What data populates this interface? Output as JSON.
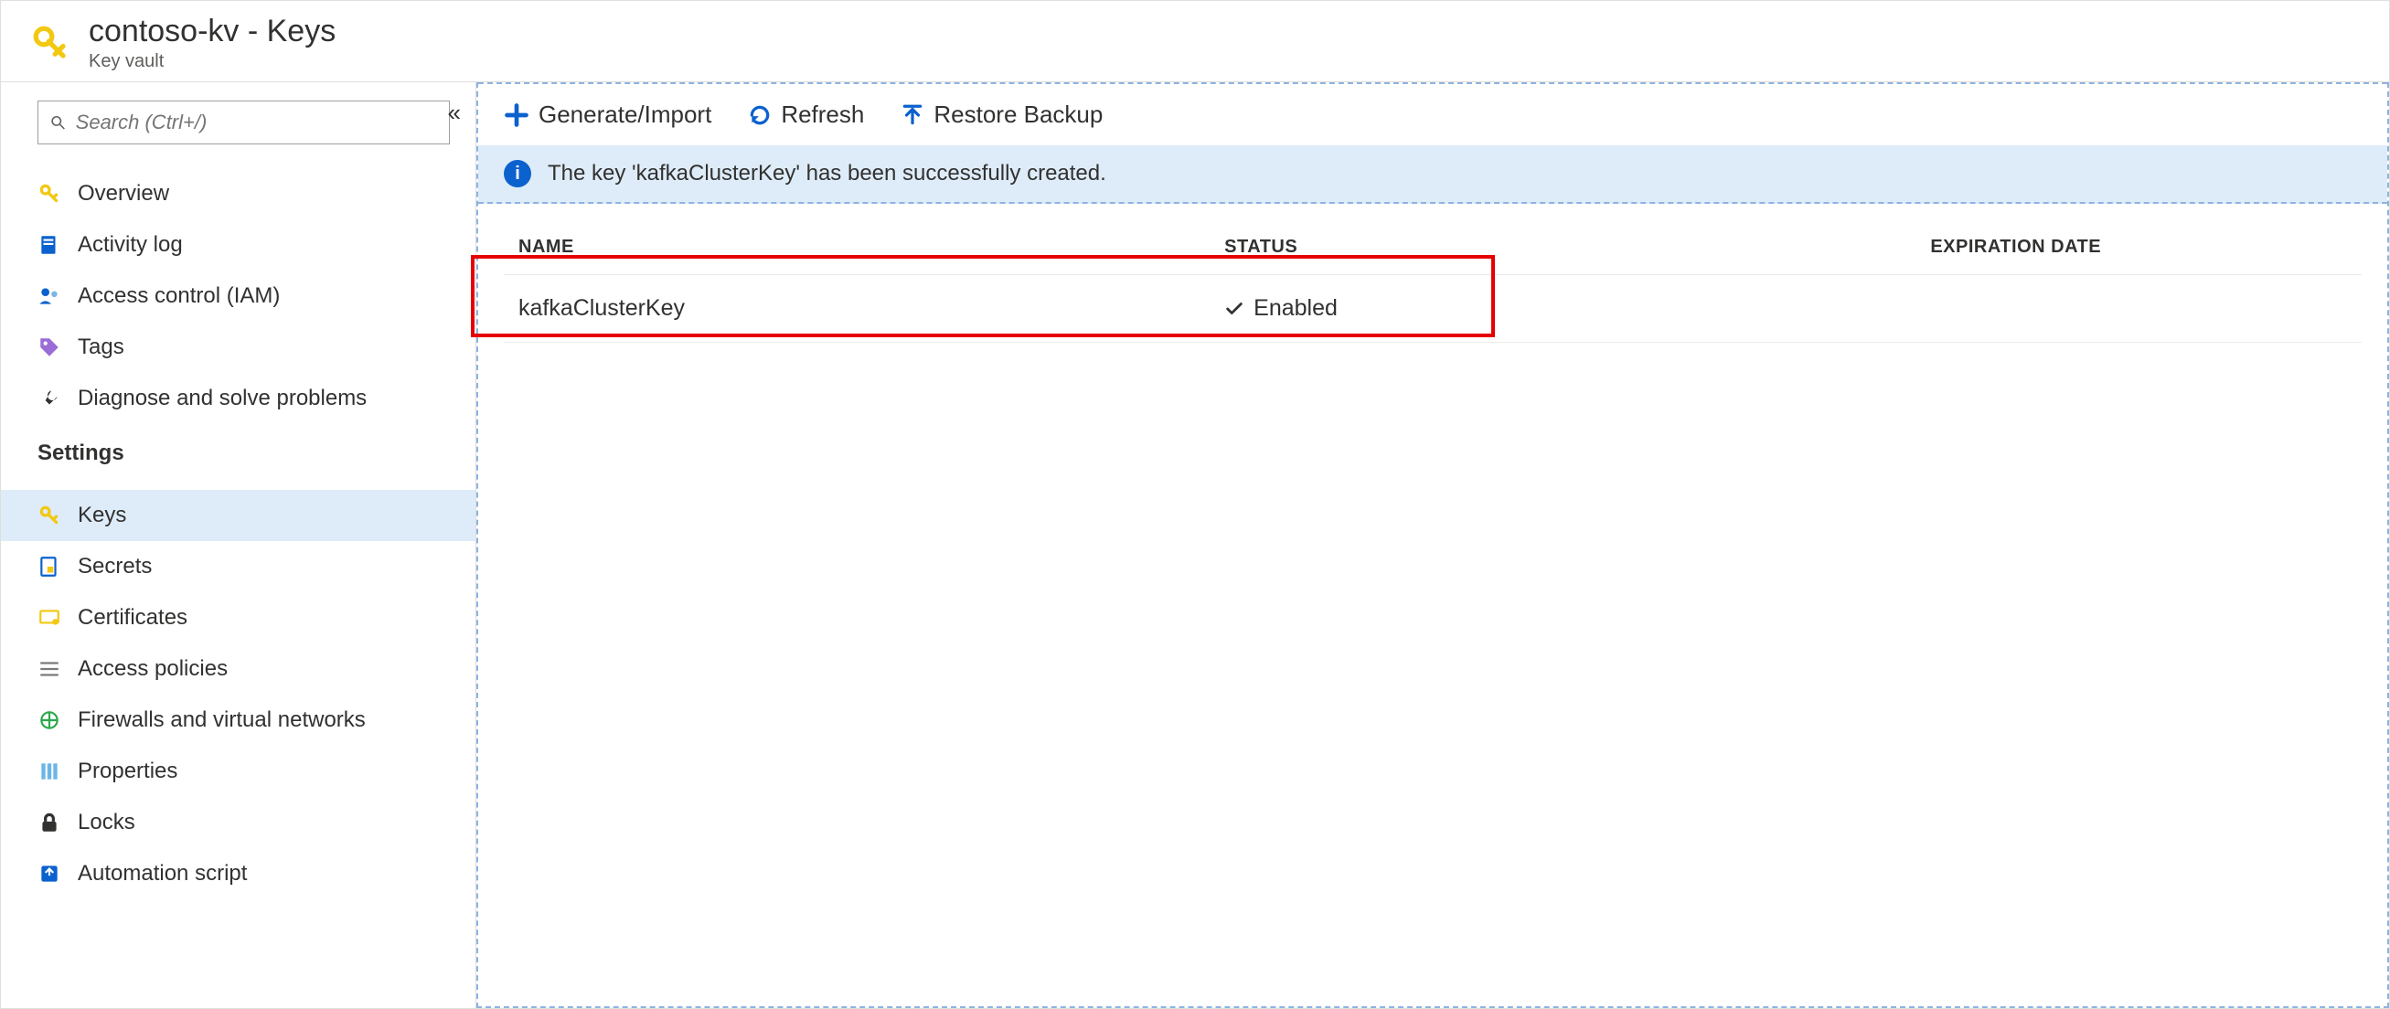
{
  "header": {
    "title": "contoso-kv - Keys",
    "subtitle": "Key vault"
  },
  "sidebar": {
    "search_placeholder": "Search (Ctrl+/)",
    "items_top": [
      {
        "label": "Overview",
        "icon": "key-yellow"
      },
      {
        "label": "Activity log",
        "icon": "log"
      },
      {
        "label": "Access control (IAM)",
        "icon": "iam"
      },
      {
        "label": "Tags",
        "icon": "tag"
      },
      {
        "label": "Diagnose and solve problems",
        "icon": "wrench"
      }
    ],
    "settings_title": "Settings",
    "items_settings": [
      {
        "label": "Keys",
        "icon": "key-yellow",
        "active": true
      },
      {
        "label": "Secrets",
        "icon": "secret"
      },
      {
        "label": "Certificates",
        "icon": "cert"
      },
      {
        "label": "Access policies",
        "icon": "policies"
      },
      {
        "label": "Firewalls and virtual networks",
        "icon": "firewall"
      },
      {
        "label": "Properties",
        "icon": "props"
      },
      {
        "label": "Locks",
        "icon": "lock"
      },
      {
        "label": "Automation script",
        "icon": "script"
      }
    ]
  },
  "toolbar": {
    "generate_label": "Generate/Import",
    "refresh_label": "Refresh",
    "restore_label": "Restore Backup"
  },
  "notification": {
    "text": "The key 'kafkaClusterKey' has been successfully created."
  },
  "table": {
    "col_name": "NAME",
    "col_status": "STATUS",
    "col_exp": "EXPIRATION DATE",
    "rows": [
      {
        "name": "kafkaClusterKey",
        "status": "Enabled",
        "expiration": ""
      }
    ]
  }
}
